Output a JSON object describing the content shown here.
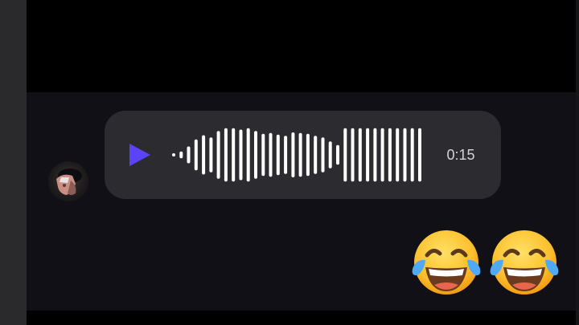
{
  "voice_message": {
    "duration": "0:15",
    "accent_color": "#5b44f6",
    "waveform_levels": [
      0.05,
      0.12,
      0.3,
      0.55,
      0.7,
      0.62,
      0.85,
      0.95,
      0.95,
      0.9,
      0.95,
      0.85,
      0.75,
      0.78,
      0.72,
      0.68,
      0.8,
      0.78,
      0.75,
      0.68,
      0.62,
      0.48,
      0.35,
      0.95,
      0.95,
      0.95,
      0.95,
      0.95,
      0.95,
      0.95,
      0.95,
      0.95,
      0.95,
      0.95
    ]
  },
  "reactions": [
    {
      "icon": "face-with-tears-of-joy-icon"
    },
    {
      "icon": "face-with-tears-of-joy-icon"
    }
  ],
  "colors": {
    "chat_background": "#101016",
    "bubble": "#2b2b30",
    "sidebar": "#2a2a2c"
  }
}
